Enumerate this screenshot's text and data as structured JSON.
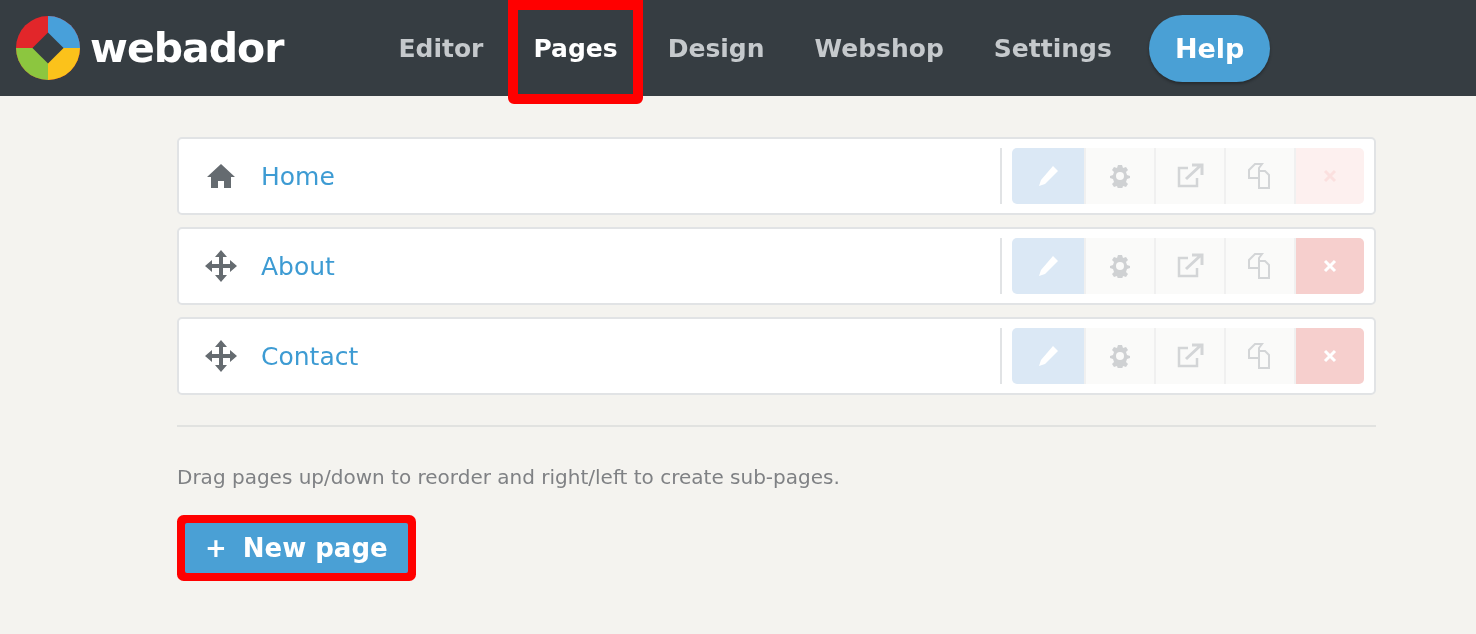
{
  "header": {
    "logo_text": "webador",
    "nav": [
      {
        "label": "Editor",
        "selected": false,
        "highlighted": false
      },
      {
        "label": "Pages",
        "selected": true,
        "highlighted": true
      },
      {
        "label": "Design",
        "selected": false,
        "highlighted": false
      },
      {
        "label": "Webshop",
        "selected": false,
        "highlighted": false
      },
      {
        "label": "Settings",
        "selected": false,
        "highlighted": false
      }
    ],
    "help_button": "Help"
  },
  "pages": [
    {
      "kind": "home",
      "title": "Home",
      "delete_disabled": true
    },
    {
      "kind": "page",
      "title": "About",
      "delete_disabled": false
    },
    {
      "kind": "page",
      "title": "Contact",
      "delete_disabled": false
    }
  ],
  "hint": "Drag pages up/down to reorder and right/left to create sub-pages.",
  "new_page_button": {
    "icon": "+",
    "label": "New page",
    "highlighted": true
  }
}
